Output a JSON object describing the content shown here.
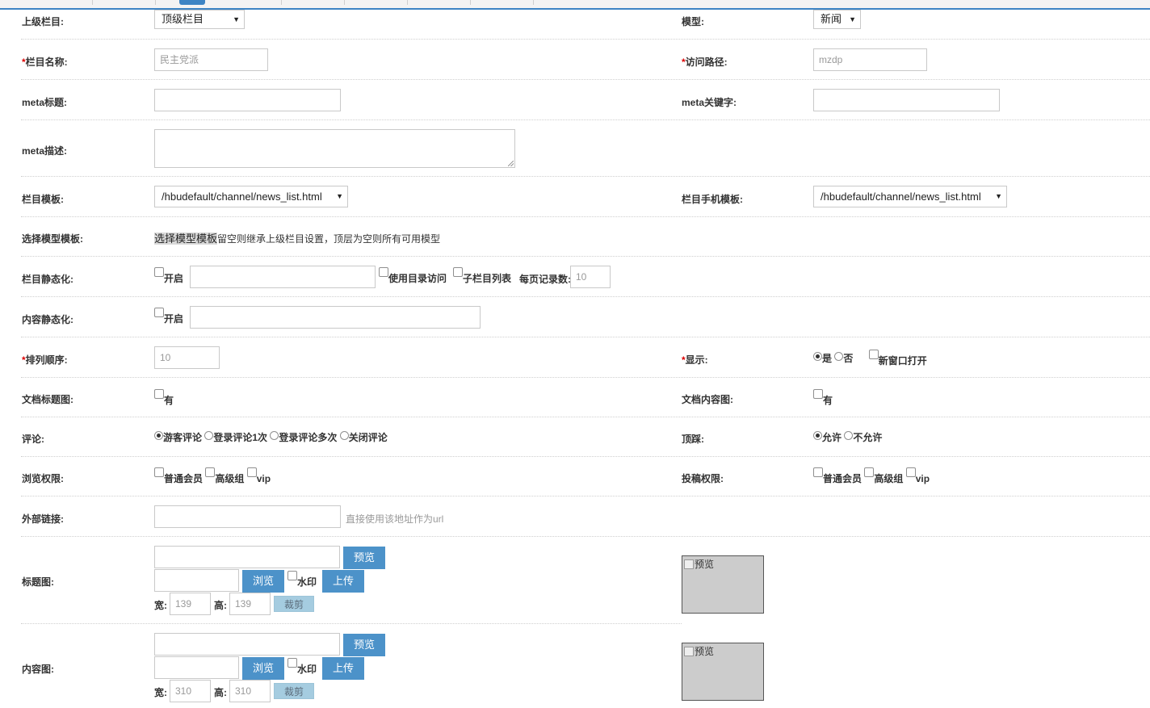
{
  "form": {
    "parent": {
      "label": "上级栏目:",
      "value": "顶级栏目"
    },
    "model": {
      "label": "模型:",
      "value": "新闻"
    },
    "name": {
      "required": "*",
      "label": "栏目名称:",
      "value": "民主党派"
    },
    "path": {
      "required": "*",
      "label": "访问路径:",
      "value": "mzdp"
    },
    "meta_title": {
      "label": "meta标题:",
      "value": ""
    },
    "meta_keywords": {
      "label": "meta关键字:",
      "value": ""
    },
    "meta_desc": {
      "label": "meta描述:",
      "value": ""
    },
    "tpl": {
      "label": "栏目模板:",
      "value": "/hbudefault/channel/news_list.html"
    },
    "mobile_tpl": {
      "label": "栏目手机模板:",
      "value": "/hbudefault/channel/news_list.html"
    },
    "model_tpl": {
      "label": "选择模型模板:",
      "link": "选择模型模板",
      "hint": "留空则继承上级栏目设置，顶层为空则所有可用模型"
    },
    "channel_static": {
      "label": "栏目静态化:",
      "enable": "开启",
      "use_dir": "使用目录访问",
      "sub_list": "子栏目列表",
      "per_page_label": "每页记录数:",
      "per_page": "10"
    },
    "content_static": {
      "label": "内容静态化:",
      "enable": "开启"
    },
    "order": {
      "required": "*",
      "label": "排列顺序:",
      "value": "10"
    },
    "display": {
      "required": "*",
      "label": "显示:",
      "yes": "是",
      "no": "否",
      "new_window": "新窗口打开"
    },
    "title_img": {
      "label": "文档标题图:",
      "has": "有"
    },
    "content_img": {
      "label": "文档内容图:",
      "has": "有"
    },
    "comment": {
      "label": "评论:",
      "options": [
        "游客评论",
        "登录评论1次",
        "登录评论多次",
        "关闭评论"
      ]
    },
    "updown": {
      "label": "顶踩:",
      "allow": "允许",
      "disallow": "不允许"
    },
    "view_perm": {
      "label": "浏览权限:",
      "groups": [
        "普通会员",
        "高级组",
        "vip"
      ]
    },
    "contrib_perm": {
      "label": "投稿权限:",
      "groups": [
        "普通会员",
        "高级组",
        "vip"
      ]
    },
    "external_link": {
      "label": "外部链接:",
      "hint": "直接使用该地址作为url"
    },
    "title_pic": {
      "label": "标题图:",
      "width": "139",
      "height": "139"
    },
    "content_pic": {
      "label": "内容图:",
      "width": "310",
      "height": "310"
    }
  },
  "buttons": {
    "preview": "预览",
    "browse": "浏览",
    "watermark": "水印",
    "upload": "上传",
    "crop": "裁剪",
    "width_label": "宽:",
    "height_label": "高:"
  },
  "preview_alt": "预览"
}
